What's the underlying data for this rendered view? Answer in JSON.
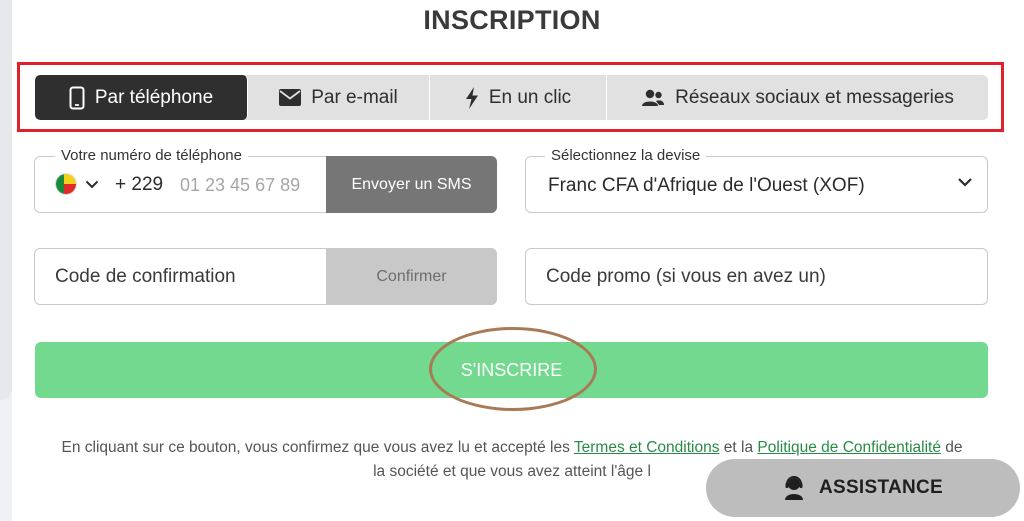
{
  "title": "INSCRIPTION",
  "tabs": [
    {
      "label": "Par téléphone",
      "icon": "phone-icon",
      "active": true
    },
    {
      "label": "Par e-mail",
      "icon": "envelope-icon",
      "active": false
    },
    {
      "label": "En un clic",
      "icon": "lightning-icon",
      "active": false
    },
    {
      "label": "Réseaux sociaux et messageries",
      "icon": "users-icon",
      "active": false
    }
  ],
  "phone": {
    "legend": "Votre numéro de téléphone",
    "country_flag": "benin-flag-icon",
    "prefix": "+ 229",
    "placeholder": "01 23 45 67 89",
    "sms_button": "Envoyer un SMS"
  },
  "currency": {
    "legend": "Sélectionnez la devise",
    "value": "Franc CFA d'Afrique de l'Ouest (XOF)"
  },
  "confirmation": {
    "placeholder": "Code de confirmation",
    "button": "Confirmer"
  },
  "promo": {
    "placeholder": "Code promo (si vous en avez un)"
  },
  "register_button": "S'INSCRIRE",
  "terms": {
    "before": "En cliquant sur ce bouton, vous confirmez que vous avez lu et accepté les",
    "link1": "Termes et Conditions",
    "middle": "et la",
    "link2": "Politique de Confidentialité",
    "after": "de la société et que vous avez atteint l'âge l"
  },
  "assistance_button": "ASSISTANCE",
  "colors": {
    "active_tab": "#2f2f2f",
    "register": "#72d98f",
    "highlight_box": "#e0202a",
    "oval": "#a87a55",
    "link": "#2a8a48"
  }
}
